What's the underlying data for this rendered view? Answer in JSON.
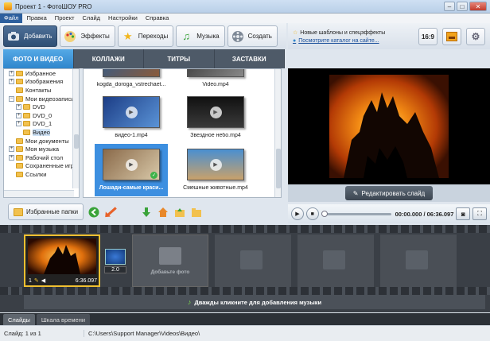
{
  "window": {
    "title": "Проект 1 - ФотоШОУ PRO",
    "min": "–",
    "max": "□",
    "close": "✕"
  },
  "menu": [
    "Файл",
    "Правка",
    "Проект",
    "Слайд",
    "Настройки",
    "Справка"
  ],
  "toolbar": {
    "add": "Добавить",
    "effects": "Эффекты",
    "transitions": "Переходы",
    "music": "Музыка",
    "create": "Создать"
  },
  "tabs": [
    "ФОТО И ВИДЕО",
    "КОЛЛАЖИ",
    "ТИТРЫ",
    "ЗАСТАВКИ"
  ],
  "tree": [
    "Избранное",
    "Изображения",
    "Контакты",
    "Мои видеозаписи",
    "DVD",
    "DVD_0",
    "DVD_1",
    "Видео",
    "Мои документы",
    "Моя музыка",
    "Рабочий стол",
    "Сохраненные игры",
    "Ссылки"
  ],
  "files": [
    {
      "name": "kogda_doroga_vstrechaet..."
    },
    {
      "name": "Video.mp4"
    },
    {
      "name": "видео-1.mp4"
    },
    {
      "name": "Звездное небо.mp4"
    },
    {
      "name": "Лошади-самые краси..."
    },
    {
      "name": "Смешные животные.mp4"
    }
  ],
  "bottom": {
    "favorites": "Избранные папки"
  },
  "right": {
    "templates_link": "Новые шаблоны и спецэффекты",
    "catalog_link": "Посмотрите каталог на сайте...",
    "aspect": "16:9"
  },
  "preview": {
    "edit_button": "Редактировать слайд",
    "time": "00:00.000 / 06:36.097"
  },
  "timeline": {
    "slide_number": "1",
    "slide_duration": "6:36.097",
    "transition_duration": "2.0",
    "add_photo": "Добавьте фото",
    "music_hint": "Дважды кликните для добавления музыки"
  },
  "viewtabs": [
    "Слайды",
    "Шкала времени"
  ],
  "status": {
    "slide": "Слайд: 1 из 1",
    "path": "C:\\Users\\Support Manager\\Videos\\Видео\\"
  },
  "colors": {
    "accent": "#3d8fe0",
    "tab_active": "#2f86cc",
    "selection_border": "#f0c030",
    "arrow": "#e8622a"
  }
}
